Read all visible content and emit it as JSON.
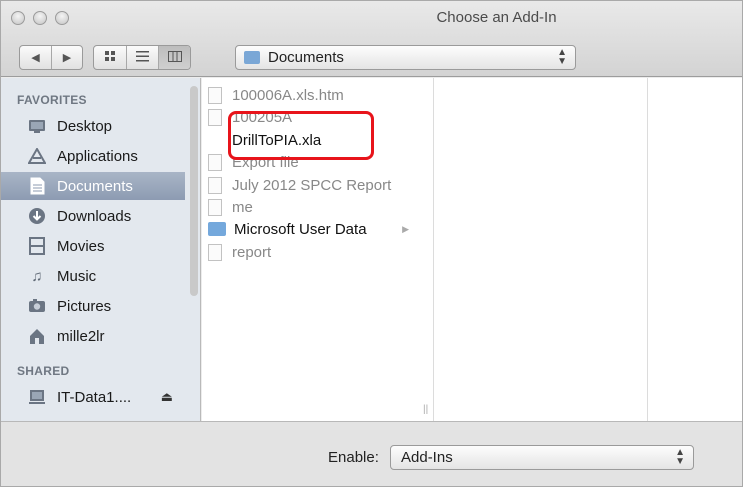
{
  "window": {
    "title": "Choose an Add-In"
  },
  "toolbar": {
    "back_icon": "chevron-left-icon",
    "forward_icon": "chevron-right-icon",
    "view_icons": [
      "icon-view-icon",
      "list-view-icon",
      "column-view-icon"
    ],
    "location": "Documents"
  },
  "sidebar": {
    "favorites_header": "FAVORITES",
    "favorites": [
      {
        "label": "Desktop",
        "icon": "desktop-icon"
      },
      {
        "label": "Applications",
        "icon": "applications-icon"
      },
      {
        "label": "Documents",
        "icon": "documents-icon",
        "selected": true
      },
      {
        "label": "Downloads",
        "icon": "downloads-icon"
      },
      {
        "label": "Movies",
        "icon": "movies-icon"
      },
      {
        "label": "Music",
        "icon": "music-icon"
      },
      {
        "label": "Pictures",
        "icon": "pictures-icon"
      },
      {
        "label": "mille2lr",
        "icon": "home-icon"
      }
    ],
    "shared_header": "SHARED",
    "shared": [
      {
        "label": "IT-Data1....",
        "icon": "network-drive-icon"
      }
    ]
  },
  "files": [
    {
      "name": "100006A.xls.htm",
      "enabled": false
    },
    {
      "name": "100205A",
      "enabled": false
    },
    {
      "name": "DrillToPIA.xla",
      "enabled": true,
      "highlighted": true
    },
    {
      "name": "Export file",
      "enabled": false
    },
    {
      "name": "July 2012 SPCC Report",
      "enabled": false
    },
    {
      "name": "me",
      "enabled": false
    },
    {
      "name": "Microsoft User Data",
      "enabled": true,
      "folder": true
    },
    {
      "name": "report",
      "enabled": false
    }
  ],
  "footer": {
    "enable_label": "Enable:",
    "enable_value": "Add-Ins"
  },
  "colors": {
    "highlight_border": "#e8141b",
    "selection": "#8d9bb2",
    "folder": "#74a8dc"
  }
}
